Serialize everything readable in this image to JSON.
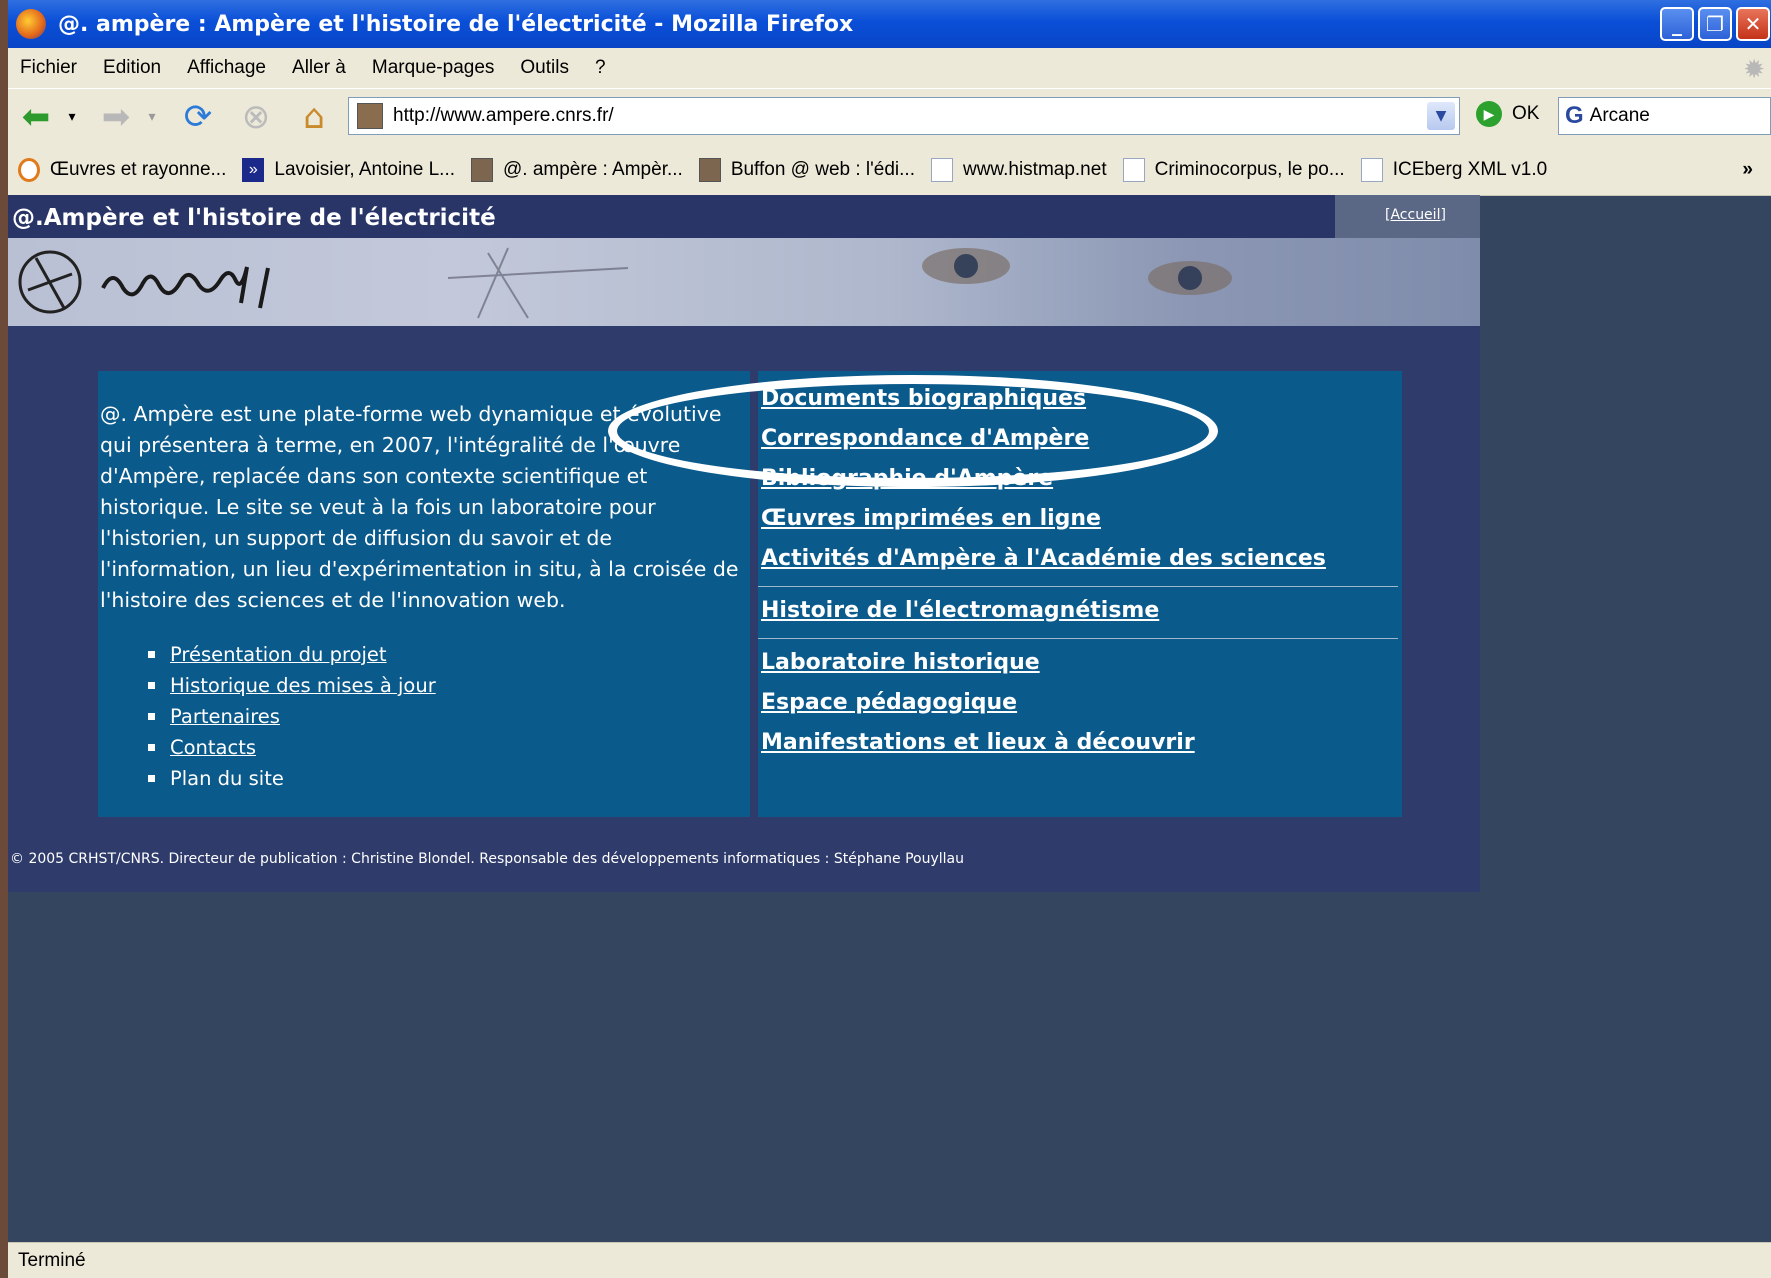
{
  "window": {
    "title": "@. ampère : Ampère et l'histoire de l'électricité - Mozilla Firefox",
    "minimize": "_",
    "restore": "❐",
    "close": "✕"
  },
  "menu": [
    "Fichier",
    "Edition",
    "Affichage",
    "Aller à",
    "Marque-pages",
    "Outils",
    "?"
  ],
  "toolbar": {
    "url": "http://www.ampere.cnrs.fr/",
    "go_label": "OK",
    "search_value": "Arcane"
  },
  "bookmarks": [
    {
      "label": "Œuvres et rayonne...",
      "icon": "ring"
    },
    {
      "label": "Lavoisier, Antoine L...",
      "icon": "blue"
    },
    {
      "label": "@. ampère : Ampèr...",
      "icon": "img"
    },
    {
      "label": "Buffon @ web : l'édi...",
      "icon": "img"
    },
    {
      "label": "www.histmap.net",
      "icon": "page"
    },
    {
      "label": "Criminocorpus, le po...",
      "icon": "page"
    },
    {
      "label": "ICEberg XML v1.0",
      "icon": "page"
    }
  ],
  "bookmarks_more": "»",
  "site": {
    "title": "@.Ampère et l'histoire de l'électricité",
    "accueil": "[Accueil]",
    "intro": "@. Ampère est une plate-forme web dynamique et évolutive qui présentera à terme, en 2007, l'intégralité de l'œuvre d'Ampère, replacée dans son contexte scientifique et historique. Le site se veut à la fois un laboratoire pour l'historien, un support de diffusion du savoir et de l'information, un lieu d'expérimentation in situ, à la croisée de l'histoire des sciences et de l'innovation web.",
    "left_links": [
      "Présentation du projet",
      "Historique des mises à jour",
      "Partenaires",
      "Contacts"
    ],
    "left_plain": "Plan du site",
    "right_links": [
      "Documents biographiques",
      "Correspondance d'Ampère",
      "Bibliographie d'Ampère",
      "Œuvres imprimées en ligne",
      "Activités d'Ampère à l'Académie des sciences",
      "Histoire de l'électromagnétisme",
      "Laboratoire historique",
      "Espace pédagogique",
      "Manifestations et lieux à découvrir"
    ],
    "footer": "© 2005 CRHST/CNRS. Directeur de publication : Christine Blondel. Responsable des développements informatiques : Stéphane Pouyllau"
  },
  "status": "Terminé"
}
